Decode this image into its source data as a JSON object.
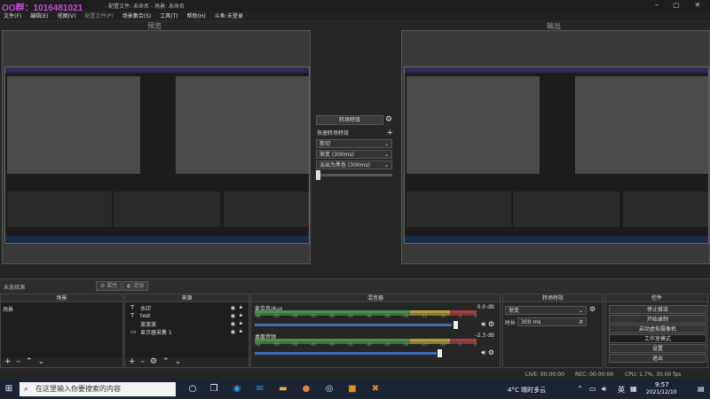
{
  "watermark": "QQ群：1016481021",
  "window_title": "- 配置文件: 未命名 - 场景: 未命名",
  "menu": {
    "items": [
      "文件(F)",
      "编辑(E)",
      "视图(V)",
      "配置文件(P)",
      "场景集合(S)",
      "工具(T)",
      "帮助(H)",
      "斗鱼:未登录"
    ],
    "dim_index": 3
  },
  "preview": {
    "left_label": "预览",
    "right_label": "输出"
  },
  "transition": {
    "button": "转场特效",
    "quick_label": "快速转场特效",
    "options": [
      "剪切",
      "渐变 (300ms)",
      "淡出为黑色 (300ms)"
    ]
  },
  "source_bar": {
    "label": "未选择源",
    "props": "属性",
    "filter": "滤镜"
  },
  "scenes": {
    "header": "场景",
    "items": [
      "场景"
    ]
  },
  "sources": {
    "header": "来源",
    "items": [
      {
        "icon": "T",
        "name": "水印"
      },
      {
        "icon": "T",
        "name": "test"
      },
      {
        "icon": " ",
        "name": "滚滚滚"
      },
      {
        "icon": "▭",
        "name": "显示器采集 1"
      }
    ]
  },
  "mixer": {
    "header": "混音器",
    "channels": [
      {
        "name": "麦克风/Aux",
        "db": "0.0 dB",
        "volume": 0.9
      },
      {
        "name": "桌面音频",
        "db": "-2.3 dB",
        "volume": 0.8
      }
    ],
    "ticks": [
      "-60",
      "-55",
      "-50",
      "-45",
      "-40",
      "-35",
      "-30",
      "-25",
      "-20",
      "-15",
      "-10",
      "-5",
      "0"
    ]
  },
  "transitions_dock": {
    "header": "转场特效",
    "selected": "渐变",
    "duration_label": "时长",
    "duration_value": "300 ms"
  },
  "controls": {
    "header": "控件",
    "buttons": [
      "停止推流",
      "开始录制",
      "启动虚拟摄像机",
      "工作室模式",
      "设置",
      "退出"
    ]
  },
  "status": {
    "live": "LIVE: 00:00:00",
    "rec": "REC: 00:00:00",
    "cpu": "CPU: 1.7%, 30.00 fps"
  },
  "taskbar": {
    "search_placeholder": "在这里输入你要搜索的内容",
    "weather": "4°C 晴时多云",
    "ime": "英",
    "time": "9:57",
    "date": "2021/12/10"
  },
  "colors": {
    "meter_green": "#4fa34f",
    "meter_yellow": "#c9b340",
    "meter_red": "#bb4444",
    "volume_blue": "#3d6fb8",
    "watermark": "#c84bd1"
  }
}
